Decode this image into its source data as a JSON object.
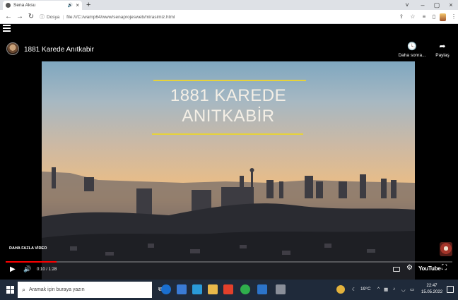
{
  "browser": {
    "tab_title": "Sena Aksu",
    "tab_audio_icon": "speaker-icon",
    "tab_close": "×",
    "new_tab": "+",
    "window_controls": [
      "˅",
      "–",
      "▢",
      "×"
    ],
    "address_prefix": "Dosya",
    "address_url": "file:///C:/wamp64/www/senaprojesweb/mirasimiz.html"
  },
  "player": {
    "channel_avatar_icon": "ataturk-portrait-icon",
    "video_title": "1881 Karede Anıtkabir",
    "watch_later_label": "Daha sonra...",
    "share_label": "Paylaş",
    "overlay_title_line1": "1881 KAREDE",
    "overlay_title_line2": "ANITKABİR",
    "more_videos_label": "DAHA FAZLA VİDEO",
    "current_time": "0:10",
    "duration": "1:28",
    "time_display": "0:10 / 1:28",
    "progress_fraction": 0.114,
    "brand_label": "YouTube",
    "accent_color": "#ff0000"
  },
  "taskbar": {
    "search_placeholder": "Aramak için buraya yazın",
    "weather": "19°C",
    "tray_caret": "^",
    "clock_time": "22:47",
    "clock_date": "15.05.2022"
  }
}
